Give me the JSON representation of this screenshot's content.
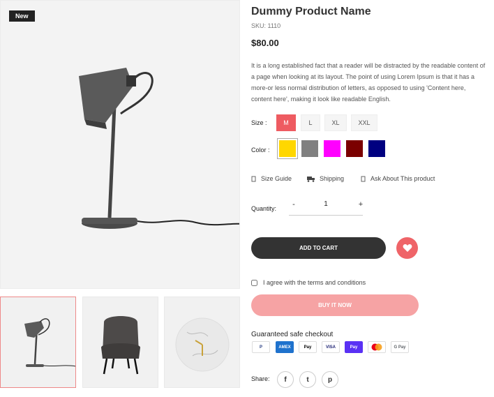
{
  "badge": "New",
  "product": {
    "title": "Dummy Product Name",
    "sku": "SKU: 1110",
    "price": "$80.00",
    "description": "It is a long established fact that a reader will be distracted by the readable content of a page when looking at its layout. The point of using Lorem Ipsum is that it has a more-or less normal distribution of letters, as opposed to using 'Content here, content here', making it look like readable English."
  },
  "size": {
    "label": "Size :",
    "options": [
      "M",
      "L",
      "XL",
      "XXL"
    ],
    "selected": "M"
  },
  "color": {
    "label": "Color :",
    "swatches": [
      "#ffd700",
      "#808080",
      "#ff00ff",
      "#7b0000",
      "#000080"
    ],
    "selected": 0
  },
  "links": {
    "size_guide": "Size Guide",
    "shipping": "Shipping",
    "ask": "Ask About This product"
  },
  "quantity": {
    "label": "Quantity:",
    "value": "1",
    "minus": "-",
    "plus": "+"
  },
  "buttons": {
    "add_to_cart": "ADD TO CART",
    "buy_now": "BUY IT NOW"
  },
  "terms": "I agree with the terms and conditions",
  "checkout": {
    "title": "Guaranteed safe checkout",
    "methods": [
      "P",
      "AMEX",
      "Pay",
      "VISA",
      "Pay",
      "",
      "G Pay"
    ]
  },
  "share": {
    "label": "Share:",
    "icons": [
      "f",
      "t",
      "p"
    ]
  },
  "colors": {
    "accent": "#ee5b61",
    "dark_button": "#333333",
    "buy_button": "#f6a3a4"
  }
}
